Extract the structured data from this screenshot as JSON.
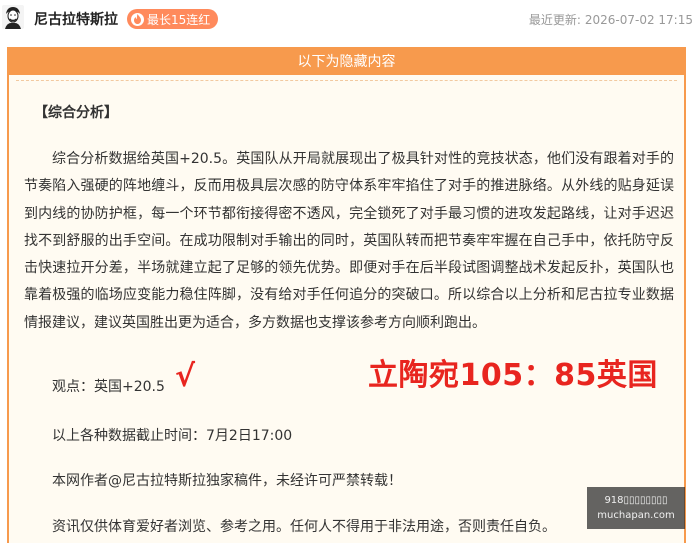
{
  "header": {
    "author": "尼古拉特斯拉",
    "streak_badge": "最长15连红",
    "update_label": "最近更新:",
    "update_time": "2026-07-02 17:15"
  },
  "panel": {
    "banner": "以下为隐藏内容",
    "section_title": "【综合分析】",
    "analysis": "综合分析数据给英国+20.5。英国队从开局就展现出了极具针对性的竞技状态，他们没有跟着对手的节奏陷入强硬的阵地缠斗，反而用极具层次感的防守体系牢牢掐住了对手的推进脉络。从外线的贴身延误到内线的协防护框，每一个环节都衔接得密不透风，完全锁死了对手最习惯的进攻发起路线，让对手迟迟找不到舒服的出手空间。在成功限制对手输出的同时，英国队转而把节奏牢牢握在自己手中，依托防守反击快速拉开分差，半场就建立起了足够的领先优势。即便对手在后半段试图调整战术发起反扑，英国队也靠着极强的临场应变能力稳住阵脚，没有给对手任何追分的突破口。所以综合以上分析和尼古拉专业数据情报建议，建议英国胜出更为适合，多方数据也支撑该参考方向顺利跑出。",
    "view": "观点：英国+20.5",
    "check_mark": "√",
    "score": "立陶宛105：85英国",
    "cutoff": "以上各种数据截止时间：7月2日17:00",
    "copyright": "本网作者@尼古拉特斯拉独家稿件，未经许可严禁转载！",
    "disclaimer": "资讯仅供体育爱好者浏览、参考之用。任何人不得用于非法用途，否则责任自负。"
  },
  "watermark": {
    "line1": "918▯▯▯▯▯▯▯▯",
    "line2": "muchapan.com"
  },
  "colors": {
    "accent": "#f79a4d",
    "streak": "#ff8a5c",
    "highlight_red": "#e8251f",
    "panel_bg": "#fffbf2"
  },
  "icons": {
    "avatar": "author-avatar",
    "flame": "flame-icon"
  }
}
